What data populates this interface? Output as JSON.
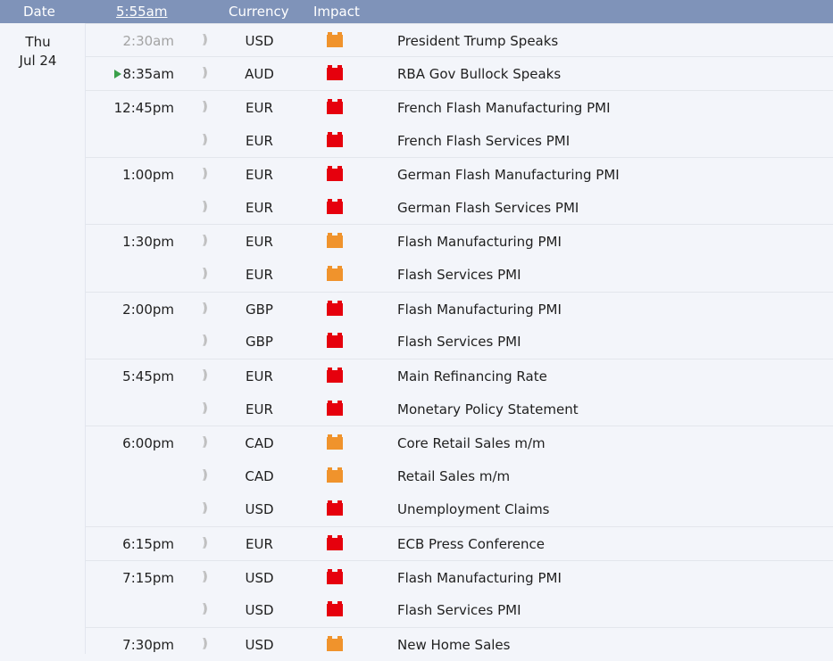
{
  "header": {
    "date_label": "Date",
    "current_time": "5:55am",
    "currency_label": "Currency",
    "impact_label": "Impact"
  },
  "day": {
    "weekday": "Thu",
    "date": "Jul 24"
  },
  "colors": {
    "header_bg": "#7f93b9",
    "impact_high": "#e6000d",
    "impact_medium": "#f0932c",
    "next_arrow": "#3aa04a"
  },
  "events": [
    {
      "time": "2:30am",
      "currency": "USD",
      "impact": "medium",
      "event": "President Trump Speaks",
      "past": true
    },
    {
      "time": "8:35am",
      "currency": "AUD",
      "impact": "high",
      "event": "RBA Gov Bullock Speaks",
      "next": true
    },
    {
      "time": "12:45pm",
      "currency": "EUR",
      "impact": "high",
      "event": "French Flash Manufacturing PMI"
    },
    {
      "time": "",
      "currency": "EUR",
      "impact": "high",
      "event": "French Flash Services PMI"
    },
    {
      "time": "1:00pm",
      "currency": "EUR",
      "impact": "high",
      "event": "German Flash Manufacturing PMI"
    },
    {
      "time": "",
      "currency": "EUR",
      "impact": "high",
      "event": "German Flash Services PMI"
    },
    {
      "time": "1:30pm",
      "currency": "EUR",
      "impact": "medium",
      "event": "Flash Manufacturing PMI"
    },
    {
      "time": "",
      "currency": "EUR",
      "impact": "medium",
      "event": "Flash Services PMI"
    },
    {
      "time": "2:00pm",
      "currency": "GBP",
      "impact": "high",
      "event": "Flash Manufacturing PMI"
    },
    {
      "time": "",
      "currency": "GBP",
      "impact": "high",
      "event": "Flash Services PMI"
    },
    {
      "time": "5:45pm",
      "currency": "EUR",
      "impact": "high",
      "event": "Main Refinancing Rate"
    },
    {
      "time": "",
      "currency": "EUR",
      "impact": "high",
      "event": "Monetary Policy Statement"
    },
    {
      "time": "6:00pm",
      "currency": "CAD",
      "impact": "medium",
      "event": "Core Retail Sales m/m"
    },
    {
      "time": "",
      "currency": "CAD",
      "impact": "medium",
      "event": "Retail Sales m/m"
    },
    {
      "time": "",
      "currency": "USD",
      "impact": "high",
      "event": "Unemployment Claims"
    },
    {
      "time": "6:15pm",
      "currency": "EUR",
      "impact": "high",
      "event": "ECB Press Conference"
    },
    {
      "time": "7:15pm",
      "currency": "USD",
      "impact": "high",
      "event": "Flash Manufacturing PMI"
    },
    {
      "time": "",
      "currency": "USD",
      "impact": "high",
      "event": "Flash Services PMI"
    },
    {
      "time": "7:30pm",
      "currency": "USD",
      "impact": "medium",
      "event": "New Home Sales"
    }
  ]
}
